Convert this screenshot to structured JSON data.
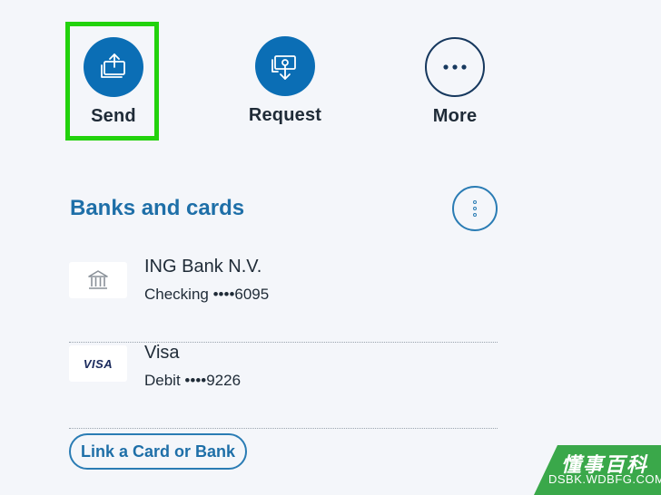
{
  "actions": {
    "send_label": "Send",
    "request_label": "Request",
    "more_label": "More"
  },
  "banks_and_cards": {
    "title": "Banks and cards",
    "items": [
      {
        "name": "ING Bank N.V.",
        "detail": "Checking ••••6095",
        "icon": "bank-icon"
      },
      {
        "name": "Visa",
        "detail": "Debit ••••9226",
        "logo_text": "VISA"
      }
    ],
    "link_button_label": "Link a Card or Bank"
  },
  "watermark": {
    "title": "懂事百科",
    "subtitle": "DSBK.WDBFG.COM"
  },
  "colors": {
    "primary_blue": "#0b6eb5",
    "heading_blue": "#1e6fa8",
    "highlight_green": "#22d20c",
    "watermark_green": "#3aa84a"
  }
}
